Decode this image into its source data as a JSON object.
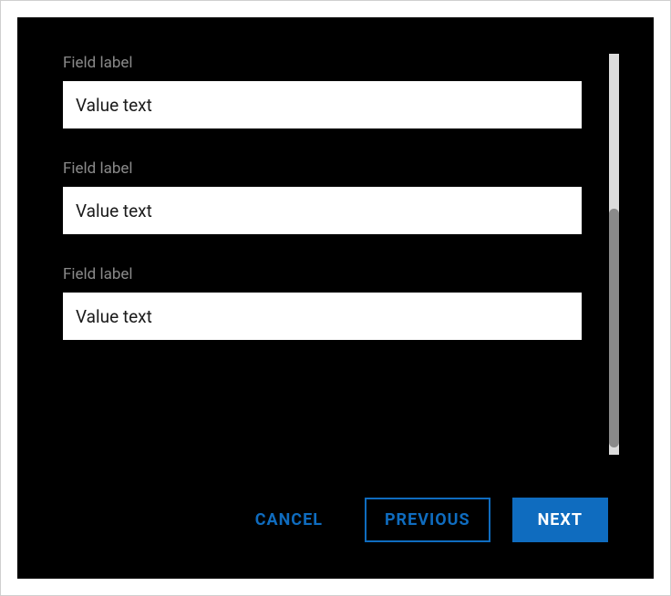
{
  "form": {
    "fields": [
      {
        "label": "Field label",
        "value": "Value text"
      },
      {
        "label": "Field label",
        "value": "Value text"
      },
      {
        "label": "Field label",
        "value": "Value text"
      }
    ]
  },
  "buttons": {
    "cancel": "Cancel",
    "previous": "Previous",
    "next": "Next"
  }
}
